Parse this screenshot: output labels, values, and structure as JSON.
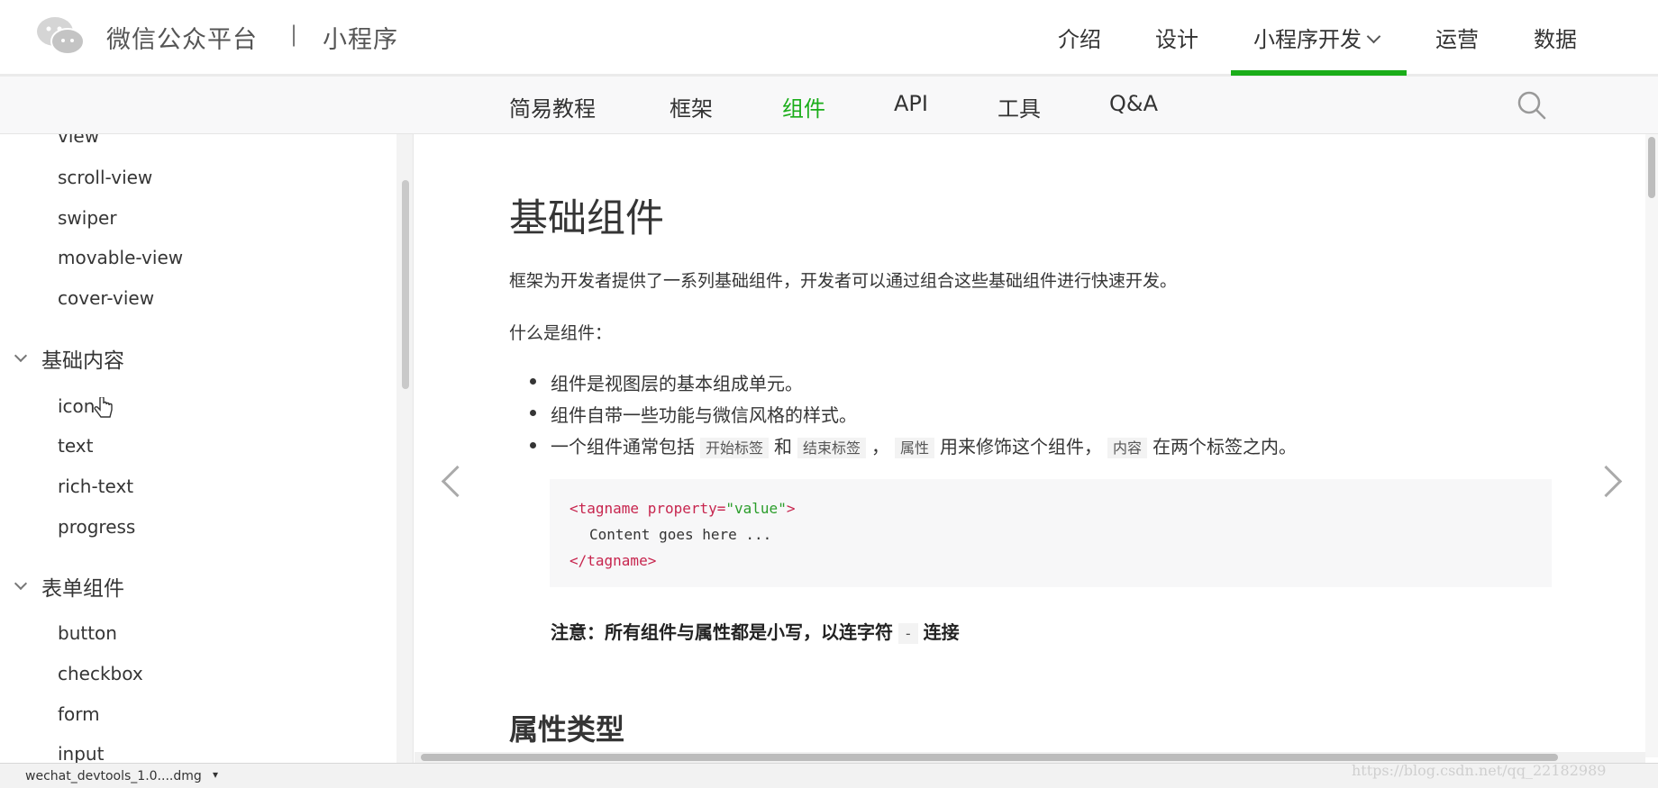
{
  "header": {
    "brand": "微信公众平台",
    "separator": "|",
    "product": "小程序",
    "nav": [
      "介绍",
      "设计",
      "小程序开发",
      "运营",
      "数据"
    ],
    "active_nav": "小程序开发",
    "accent_color": "#1aad19"
  },
  "subnav": {
    "items": [
      "简易教程",
      "框架",
      "组件",
      "API",
      "工具",
      "Q&A"
    ],
    "active": "组件",
    "search_icon": "search-icon"
  },
  "sidebar": {
    "view_items": [
      "view",
      "scroll-view",
      "swiper",
      "movable-view",
      "cover-view"
    ],
    "group_basic": "基础内容",
    "basic_items": [
      "icon",
      "text",
      "rich-text",
      "progress"
    ],
    "group_form": "表单组件",
    "form_items": [
      "button",
      "checkbox",
      "form",
      "input"
    ]
  },
  "content": {
    "title": "基础组件",
    "intro": "框架为开发者提供了一系列基础组件，开发者可以通过组合这些基础组件进行快速开发。",
    "what_is": "什么是组件：",
    "bullet1": "组件是视图层的基本组成单元。",
    "bullet2": "组件自带一些功能与微信风格的样式。",
    "bullet3": {
      "p1": "一个组件通常包括",
      "c1": "开始标签",
      "p2": "和",
      "c2": "结束标签",
      "p3": "，",
      "c3": "属性",
      "p4": "用来修饰这个组件，",
      "c4": "内容",
      "p5": "在两个标签之内。"
    },
    "code": {
      "open_tag": "<tagname property=",
      "attr_value": "\"value\"",
      "open_tag_end": ">",
      "body": "Content goes here ...",
      "close_tag": "</tagname>"
    },
    "note": {
      "pre": "注意：所有组件与属性都是小写，以连字符",
      "code": "-",
      "post": "连接"
    },
    "section2": "属性类型"
  },
  "downloads": {
    "file": "wechat_devtools_1.0....dmg",
    "menu": "▾"
  },
  "watermark": "https://blog.csdn.net/qq_22182989"
}
